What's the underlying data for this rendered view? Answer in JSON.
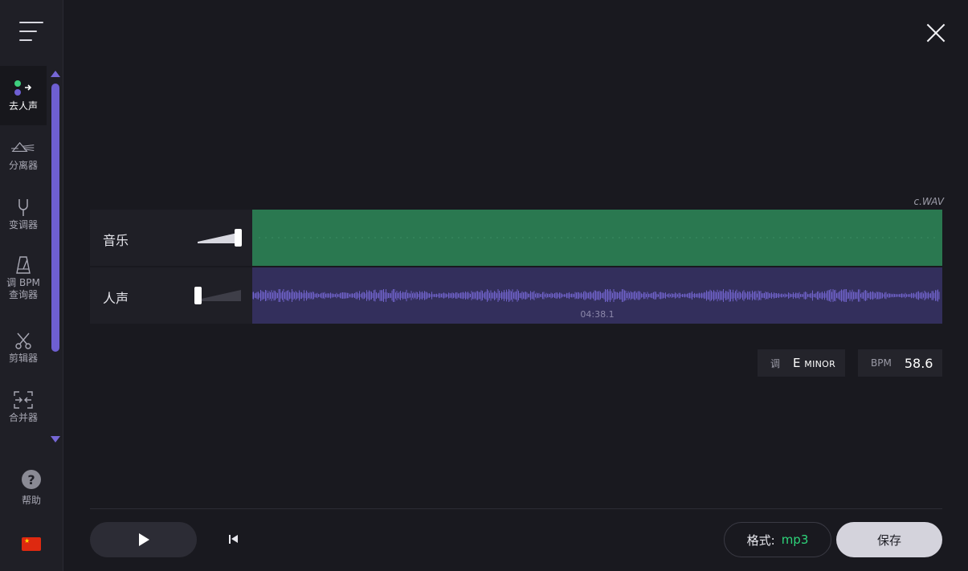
{
  "sidebar": {
    "menu_icon": "hamburger-menu-icon",
    "items": [
      {
        "label": "去人声",
        "icon": "vocal-remover-icon",
        "active": true
      },
      {
        "label": "分离器",
        "icon": "prism-splitter-icon",
        "active": false
      },
      {
        "label": "变调器",
        "icon": "tuning-fork-icon",
        "active": false
      },
      {
        "label": "调 BPM\n查询器",
        "icon": "metronome-icon",
        "active": false
      },
      {
        "label": "剪辑器",
        "icon": "scissors-icon",
        "active": false
      },
      {
        "label": "合并器",
        "icon": "joiner-icon",
        "active": false
      }
    ],
    "help_label": "帮助",
    "help_icon": "question-circle-icon",
    "language_icon": "china-flag-icon"
  },
  "file_name": "c.WAV",
  "tracks": [
    {
      "name": "音乐",
      "volume": 1.0,
      "color": "#2a7850"
    },
    {
      "name": "人声",
      "volume": 0.0,
      "color": "#332f5c",
      "wave_color": "#6f62c9"
    }
  ],
  "timecode": "04:38.1",
  "key": {
    "label": "调",
    "value_letter": "E",
    "value_mode": "minor"
  },
  "bpm": {
    "label": "BPM",
    "value": "58.6"
  },
  "controls": {
    "play_icon": "play-icon",
    "rewind_icon": "skip-to-start-icon",
    "format_label": "格式:",
    "format_value": "mp3",
    "save_label": "保存"
  },
  "colors": {
    "accent": "#6e5fd2",
    "format_green": "#2ed47a",
    "background": "#19191f"
  }
}
